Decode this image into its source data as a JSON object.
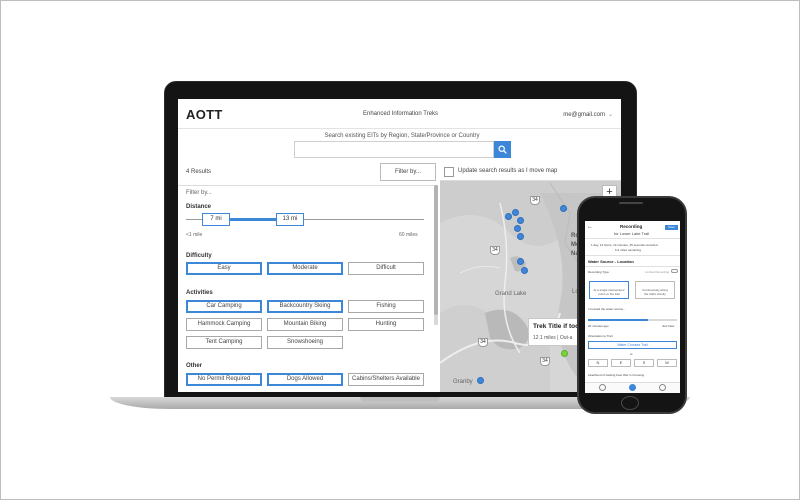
{
  "app": {
    "logo": "AOTT",
    "title": "Enhanced Information Treks",
    "account": "me@gmail.com",
    "search_label": "Search existing EITs by Region, State/Province or Country",
    "search_value": ""
  },
  "left_panel": {
    "results_count": "4 Results",
    "filter_button": "Filter by...",
    "filter_label": "Filter by...",
    "distance": {
      "title": "Distance",
      "min_value": "7 mi",
      "max_value": "13 mi",
      "range_min_label": "<1 mile",
      "range_max_label": "60 miles"
    },
    "difficulty": {
      "title": "Difficulty",
      "options": [
        "Easy",
        "Moderate",
        "Difficult"
      ]
    },
    "activities": {
      "title": "Activities",
      "options": [
        "Car Camping",
        "Backcountry Skiing",
        "Fishing",
        "Hammock Camping",
        "Mountain Biking",
        "Hunting",
        "Tent Camping",
        "Snowshoeing"
      ]
    },
    "other": {
      "title": "Other",
      "options": [
        "No Permit Required",
        "Dogs Allowed",
        "Cabins/Shelters Available"
      ]
    }
  },
  "map": {
    "update_label": "Update search results as I move map",
    "zoom_in": "+",
    "labels": {
      "grand_lake": "Grand Lake",
      "granby": "Granby",
      "rocky": "Rocky",
      "mountain": "Mountain",
      "national": "National P",
      "longs": "Longs P"
    },
    "shields": [
      "34",
      "34",
      "34",
      "34"
    ],
    "popup": {
      "title": "Trek Title if too",
      "subtitle": "12.1 miles | Out-a"
    }
  },
  "phone": {
    "header_title": "Recording",
    "header_sub": "for Lower Lake Trail",
    "save_label": "Save",
    "stats_line1": "1 day, 13 hours, 13 minutes, 45 seconds recorded",
    "stats_line2": "6.4 miles remaining",
    "section_title": "Water Source - Location",
    "recording_type": "Recording Type",
    "limited_recording": "Limited Recording",
    "option_a_line1": "At a single intersection/",
    "option_a_line2": "point on the trail",
    "option_b_line1": "Continuously along",
    "option_b_line2": "the trail's vicinity",
    "located_label": "I crossed the water source...",
    "progress_left": "20 minutes ago",
    "progress_right": "Just Now",
    "orientation_label": "Orientation to Trail",
    "field_value": "Water Crosses Trail",
    "or_label": "or",
    "segments": [
      "N",
      "E",
      "S",
      "W"
    ],
    "likelihood_label": "Likelihood of Getting Feet Wet in Crossing"
  },
  "colors": {
    "accent": "#3d87d9",
    "pin_blue": "#3f86d9",
    "pin_green": "#7bd13a",
    "map_bg": "#d4d4d4"
  }
}
